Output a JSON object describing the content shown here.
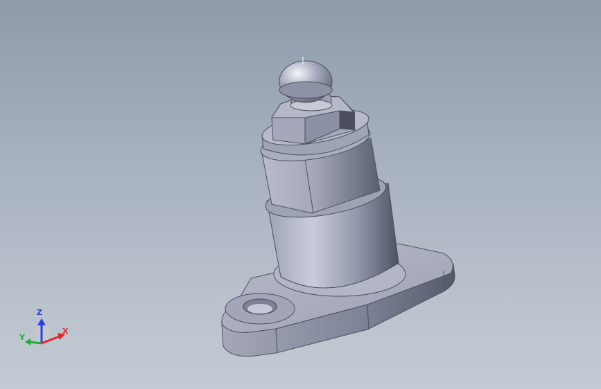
{
  "triad": {
    "x_label": "X",
    "y_label": "Y",
    "z_label": "Z",
    "x_color": "#e0262b",
    "y_color": "#1fae35",
    "z_color": "#2a3fd6"
  },
  "model": {
    "part_color": "#a8adbf"
  }
}
